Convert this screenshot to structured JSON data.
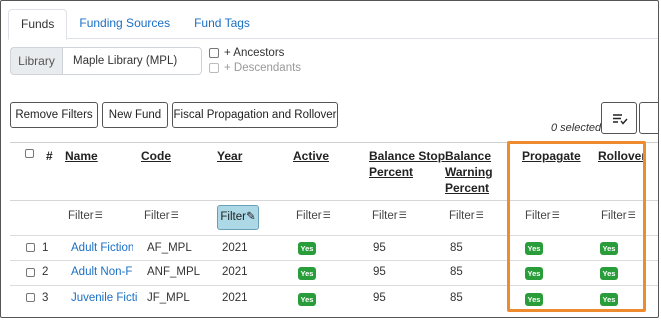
{
  "tabs": [
    {
      "label": "Funds",
      "active": true
    },
    {
      "label": "Funding Sources",
      "active": false
    },
    {
      "label": "Fund Tags",
      "active": false
    }
  ],
  "library": {
    "label": "Library",
    "value": "Maple Library (MPL)",
    "ancestors_label": "+ Ancestors",
    "descendants_label": "+ Descendants"
  },
  "toolbar": {
    "remove_filters": "Remove Filters",
    "new_fund": "New Fund",
    "propagation": "Fiscal Propagation and Rollover",
    "selected": "0 selected",
    "sort_icon": "sort-lines-check-icon"
  },
  "columns": {
    "num": "#",
    "name": "Name",
    "code": "Code",
    "year": "Year",
    "active": "Active",
    "balance_stop_1": "Balance Stop",
    "balance_stop_2": "Percent",
    "balance_warning_1": "Balance",
    "balance_warning_2": "Warning",
    "balance_warning_3": "Percent",
    "propagate": "Propagate",
    "rollover": "Rollover"
  },
  "filter_label": "Filter",
  "rows": [
    {
      "num": "1",
      "name": "Adult Fiction",
      "code": "AF_MPL",
      "year": "2021",
      "active": "Yes",
      "stop": "95",
      "warning": "85",
      "propagate": "Yes",
      "rollover": "Yes"
    },
    {
      "num": "2",
      "name": "Adult Non-F",
      "code": "ANF_MPL",
      "year": "2021",
      "active": "Yes",
      "stop": "95",
      "warning": "85",
      "propagate": "Yes",
      "rollover": "Yes"
    },
    {
      "num": "3",
      "name": "Juvenile Ficti",
      "code": "JF_MPL",
      "year": "2021",
      "active": "Yes",
      "stop": "95",
      "warning": "85",
      "propagate": "Yes",
      "rollover": "Yes"
    }
  ],
  "colors": {
    "accent_link": "#1a6fc4",
    "badge_green": "#2a9d3b",
    "highlight_orange": "#ee8b2e",
    "active_filter": "#add8e6"
  }
}
